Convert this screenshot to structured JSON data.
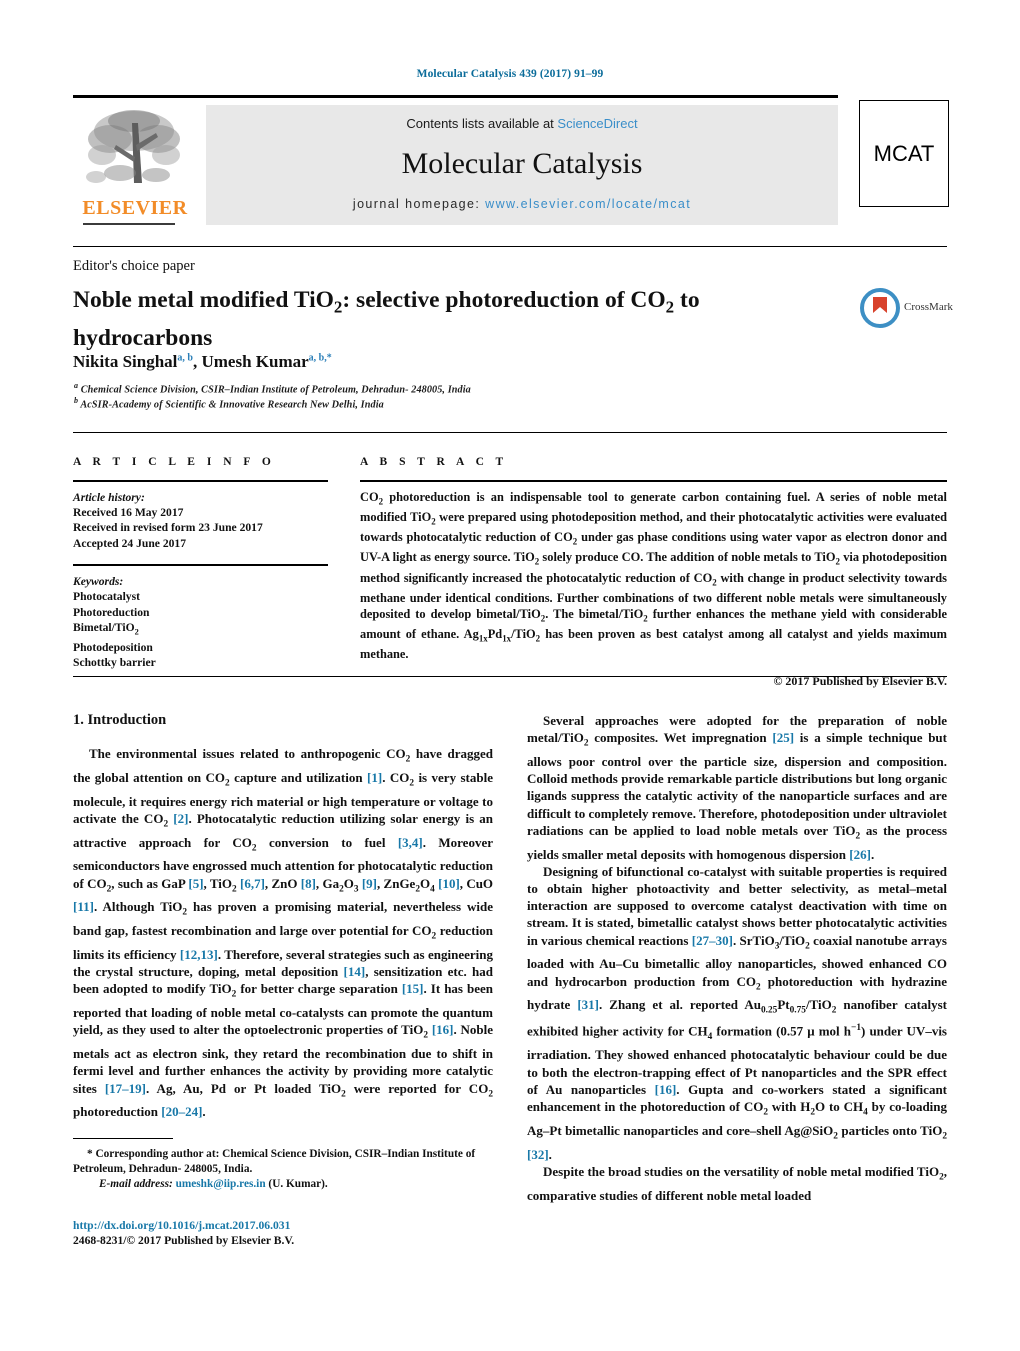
{
  "running_head": "Molecular Catalysis 439 (2017) 91–99",
  "masthead": {
    "contents_prefix": "Contents lists available at ",
    "sciencedirect": "ScienceDirect",
    "journal_title": "Molecular Catalysis",
    "homepage_prefix": "journal homepage: ",
    "homepage_url": "www.elsevier.com/locate/mcat",
    "publisher_logo_text": "ELSEVIER",
    "journal_badge": "MCAT"
  },
  "article": {
    "category": "Editor's choice paper",
    "title_part1": "Noble metal modified TiO",
    "title_sub1": "2",
    "title_part2": ": selective photoreduction of CO",
    "title_sub2": "2",
    "title_part3": " to hydrocarbons",
    "title_plain": "Noble metal modified TiO2: selective photoreduction of CO2 to hydrocarbons",
    "crossmark_label": "CrossMark",
    "authors_plain": "Nikita Singhal a,b, Umesh Kumar a,b,*",
    "author1": "Nikita Singhal",
    "author1_sup": "a, b",
    "author_sep": ", ",
    "author2": "Umesh Kumar",
    "author2_sup": "a, b,",
    "author2_star": "*",
    "affiliation_a_marker": "a",
    "affiliation_a": " Chemical Science Division, CSIR–Indian Institute of Petroleum, Dehradun- 248005, India",
    "affiliation_b_marker": "b",
    "affiliation_b": " AcSIR-Academy of Scientific & Innovative Research New Delhi, India"
  },
  "article_info": {
    "heading": "A R T I C L E    I N F O",
    "history_label": "Article history:",
    "history": [
      "Received 16 May 2017",
      "Received in revised form 23 June 2017",
      "Accepted 24 June 2017"
    ],
    "keywords_label": "Keywords:",
    "keywords": [
      "Photocatalyst",
      "Photoreduction",
      "Bimetal/TiO2",
      "Photodeposition",
      "Schottky barrier"
    ]
  },
  "abstract": {
    "heading": "A B S T R A C T",
    "text": "CO2 photoreduction is an indispensable tool to generate carbon containing fuel. A series of noble metal modified TiO2 were prepared using photodeposition method, and their photocatalytic activities were evaluated towards photocatalytic reduction of CO2 under gas phase conditions using water vapor as electron donor and UV-A light as energy source. TiO2 solely produce CO. The addition of noble metals to TiO2 via photodeposition method significantly increased the photocatalytic reduction of CO2 with change in product selectivity towards methane under identical conditions. Further combinations of two different noble metals were simultaneously deposited to develop bimetal/TiO2. The bimetal/TiO2 further enhances the methane yield with considerable amount of ethane. Ag1xPd1x/TiO2 has been proven as best catalyst among all catalyst and yields maximum methane.",
    "copyright": "© 2017 Published by Elsevier B.V."
  },
  "body": {
    "section_heading": "1.  Introduction",
    "left_paragraphs": [
      "The environmental issues related to anthropogenic CO2 have dragged the global attention on CO2 capture and utilization [1]. CO2 is very stable molecule, it requires energy rich material or high temperature or voltage to activate the CO2 [2]. Photocatalytic reduction utilizing solar energy is an attractive approach for CO2 conversion to fuel [3,4]. Moreover semiconductors have engrossed much attention for photocatalytic reduction of CO2, such as GaP [5], TiO2 [6,7], ZnO [8], Ga2O3 [9], ZnGe2O4 [10], CuO [11]. Although TiO2 has proven a promising material, nevertheless wide band gap, fastest recombination and large over potential for CO2 reduction limits its efficiency [12,13]. Therefore, several strategies such as engineering the crystal structure, doping, metal deposition [14], sensitization etc. had been adopted to modify TiO2 for better charge separation [15]. It has been reported that loading of noble metal co-catalysts can promote the quantum yield, as they used to alter the optoelectronic properties of TiO2 [16]. Noble metals act as electron sink, they retard the recombination due to shift in fermi level and further enhances the activity by providing more catalytic sites [17–19]. Ag, Au, Pd or Pt loaded TiO2 were reported for CO2 photoreduction [20–24]."
    ],
    "right_paragraphs": [
      "Several approaches were adopted for the preparation of noble metal/TiO2 composites. Wet impregnation [25] is a simple technique but allows poor control over the particle size, dispersion and composition. Colloid methods provide remarkable particle distributions but long organic ligands suppress the catalytic activity of the nanoparticle surfaces and are difficult to completely remove. Therefore, photodeposition under ultraviolet radiations can be applied to load noble metals over TiO2 as the process yields smaller metal deposits with homogenous dispersion [26].",
      "Designing of bifunctional co-catalyst with suitable properties is required to obtain higher photoactivity and better selectivity, as metal–metal interaction are supposed to overcome catalyst deactivation with time on stream. It is stated, bimetallic catalyst shows better photocatalytic activities in various chemical reactions [27–30]. SrTiO3/TiO2 coaxial nanotube arrays loaded with Au–Cu bimetallic alloy nanoparticles, showed enhanced CO and hydrocarbon production from CO2 photoreduction with hydrazine hydrate [31]. Zhang et al. reported Au0.25Pt0.75/TiO2 nanofiber catalyst exhibited higher activity for CH4 formation (0.57 μ mol h−1) under UV–vis irradiation. They showed enhanced photocatalytic behaviour could be due to both the electron-trapping effect of Pt nanoparticles and the SPR effect of Au nanoparticles [16]. Gupta and co-workers stated a significant enhancement in the photoreduction of CO2 with H2O to CH4 by co-loading Ag–Pt bimetallic nanoparticles and core–shell Ag@SiO2 particles onto TiO2 [32].",
      "Despite the broad studies on the versatility of noble metal modified TiO2, comparative studies of different noble metal loaded"
    ]
  },
  "footnote": {
    "star": "*",
    "corresponding": " Corresponding author at: Chemical Science Division, CSIR–Indian Institute of Petroleum, Dehradun- 248005, India.",
    "email_label": "E-mail address:",
    "email": "umeshk@iip.res.in",
    "email_suffix": " (U. Kumar)."
  },
  "footer": {
    "doi": "http://dx.doi.org/10.1016/j.mcat.2017.06.031",
    "issn": "2468-8231/© 2017 Published by Elsevier B.V."
  },
  "colors": {
    "link_blue": "#1878a8",
    "sciencedirect_blue": "#3a8ec9",
    "elsevier_orange": "#f28c28",
    "band_gray": "#e8e8e8"
  }
}
